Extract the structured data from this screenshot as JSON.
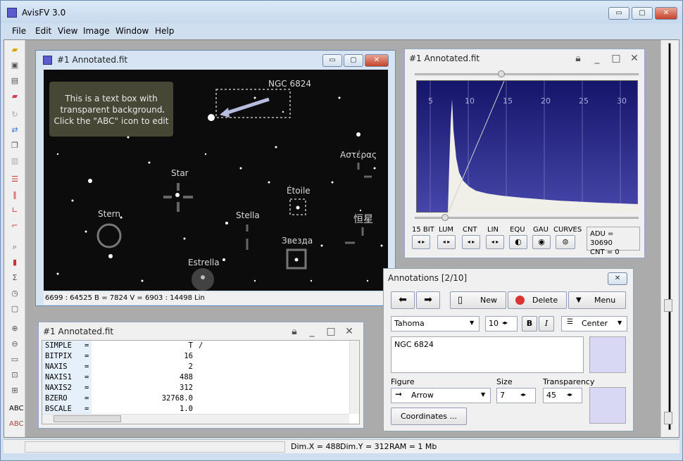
{
  "app": {
    "title": "AvisFV 3.0"
  },
  "window_controls": {
    "min": "▭",
    "max": "▢",
    "close": "✕"
  },
  "menu": [
    "File",
    "Edit",
    "View",
    "Image",
    "Window",
    "Help"
  ],
  "image_window": {
    "title": "#1 Annotated.fit",
    "status": "6699 : 64525    B = 7824    V = 6903 : 14498 Lin",
    "textbox": [
      "This is a text box with",
      "transparent background",
      "Click the \"ABC\" icon to edit"
    ],
    "labels": {
      "ngc": "NGC 6824",
      "star": "Star",
      "stern": "Stern",
      "stella": "Stella",
      "estrella": "Estrella",
      "etoile": "Étoile",
      "asteras": "Αστέρας",
      "zvezda": "Звезда",
      "xing": "恒星"
    }
  },
  "histogram": {
    "title": "#1 Annotated.fit",
    "ticks": [
      "5",
      "10",
      "15",
      "20",
      "25",
      "30"
    ],
    "controls": [
      "15 BIT",
      "LUM",
      "CNT",
      "LIN",
      "EQU",
      "GAU",
      "CURVES"
    ],
    "adu": "ADU = 30690",
    "cnt": "CNT = 0"
  },
  "fits_header": {
    "title": "#1 Annotated.fit",
    "rows": [
      {
        "key": "SIMPLE",
        "eq": "=",
        "val": "T",
        "comment": "/"
      },
      {
        "key": "BITPIX",
        "eq": "=",
        "val": "16",
        "comment": ""
      },
      {
        "key": "NAXIS",
        "eq": "=",
        "val": "2",
        "comment": ""
      },
      {
        "key": "NAXIS1",
        "eq": "=",
        "val": "488",
        "comment": ""
      },
      {
        "key": "NAXIS2",
        "eq": "=",
        "val": "312",
        "comment": ""
      },
      {
        "key": "BZERO",
        "eq": "=",
        "val": "32768.0",
        "comment": ""
      },
      {
        "key": "BSCALE",
        "eq": "=",
        "val": "1.0",
        "comment": ""
      }
    ]
  },
  "annotations": {
    "title": "Annotations  [2/10]",
    "new_label": "New",
    "delete_label": "Delete",
    "menu_label": "Menu",
    "font_value": "Tahoma",
    "font_size": "10",
    "bold": "B",
    "italic": "I",
    "align": "Center",
    "text_value": "NGC 6824",
    "figure_label": "Figure",
    "figure_value": "Arrow",
    "size_label": "Size",
    "size_value": "7",
    "transparency_label": "Transparency",
    "transparency_value": "45",
    "coordinates_label": "Coordinates ...",
    "colors": {
      "swatch": "#d8d8f4"
    }
  },
  "statusbar": {
    "dim_x": "Dim.X = 488",
    "dim_y": "Dim.Y = 312",
    "ram": "RAM = 1 Mb"
  }
}
